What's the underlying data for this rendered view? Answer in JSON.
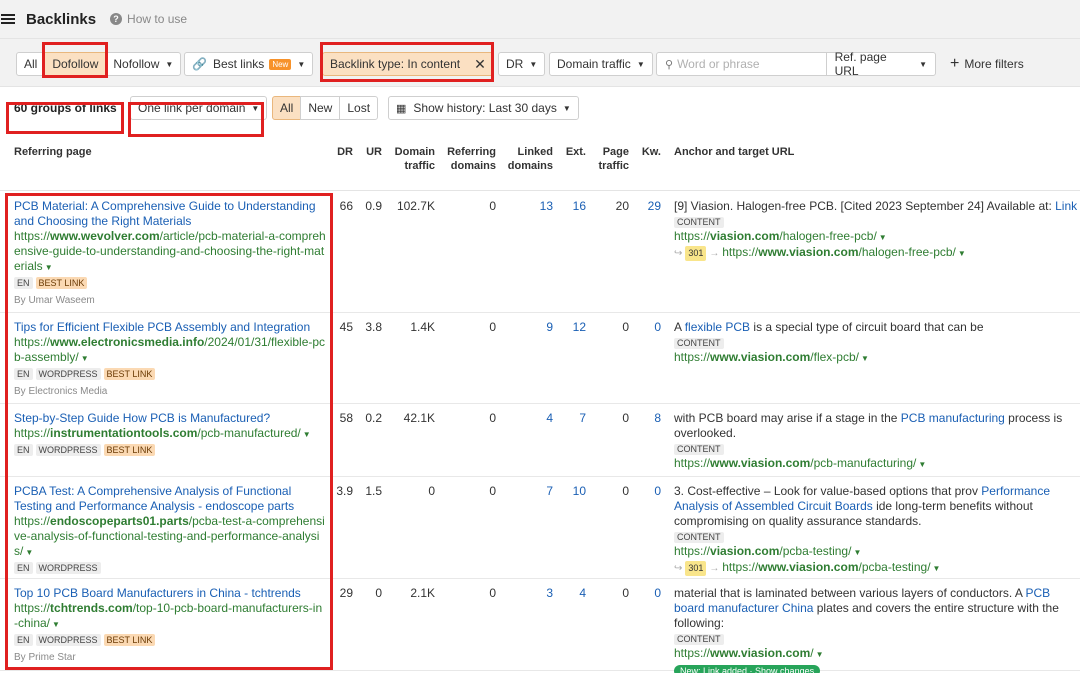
{
  "header": {
    "title": "Backlinks",
    "help": "How to use"
  },
  "filters": {
    "all": "All",
    "dofollow": "Dofollow",
    "nofollow": "Nofollow",
    "best_links": "Best links",
    "best_links_badge": "New",
    "backlink_type": "Backlink type: In content",
    "dr": "DR",
    "domain_traffic": "Domain traffic",
    "search_placeholder": "Word or phrase",
    "search_scope": "Ref. page URL",
    "more_filters": "More filters"
  },
  "subbar": {
    "groups": "60 groups of links",
    "grouping": "One link per domain",
    "tabs": [
      "All",
      "New",
      "Lost"
    ],
    "history": "Show history: Last 30 days"
  },
  "columns": {
    "referring_page": "Referring page",
    "dr": "DR",
    "ur": "UR",
    "domain_traffic": [
      "Domain",
      "traffic"
    ],
    "referring_domains": [
      "Referring",
      "domains"
    ],
    "linked_domains": [
      "Linked",
      "domains"
    ],
    "ext": "Ext.",
    "page_traffic": [
      "Page",
      "traffic"
    ],
    "kw": "Kw.",
    "anchor": "Anchor and target URL"
  },
  "rows": [
    {
      "title": "PCB Material: A Comprehensive Guide to Understanding and Choosing the Right Materials",
      "url_prefix": "https://",
      "url_domain": "www.wevolver.com",
      "url_path": "/article/pcb-material-a-comprehensive-guide-to-understanding-and-choosing-the-right-materials",
      "tags": [
        "EN",
        "BEST LINK"
      ],
      "author": "By Umar Waseem",
      "dr": "66",
      "ur": "0.9",
      "domain_traffic": "102.7K",
      "referring_domains": "0",
      "linked_domains": "13",
      "ext": "16",
      "page_traffic": "20",
      "kw": "29",
      "anchor_text": "[9] Viasion. Halogen-free PCB. [Cited 2023 September 24] Available at: ",
      "anchor_link": "Link",
      "anchor_after": "",
      "content": "CONTENT",
      "target_prefix": "https://",
      "target_domain": "viasion.com",
      "target_path": "/halogen-free-pcb/",
      "redirect": "301",
      "redirect_prefix": "https://",
      "redirect_domain": "www.viasion.com",
      "redirect_path": "/halogen-free-pcb/"
    },
    {
      "title": "Tips for Efficient Flexible PCB Assembly and Integration",
      "url_prefix": "https://",
      "url_domain": "www.electronicsmedia.info",
      "url_path": "/2024/01/31/flexible-pcb-assembly/",
      "tags": [
        "EN",
        "WORDPRESS",
        "BEST LINK"
      ],
      "author": "By Electronics Media",
      "dr": "45",
      "ur": "3.8",
      "domain_traffic": "1.4K",
      "referring_domains": "0",
      "linked_domains": "9",
      "ext": "12",
      "page_traffic": "0",
      "kw": "0",
      "anchor_text": "A ",
      "anchor_link": "flexible PCB",
      "anchor_after": " is a special type of circuit board that can be",
      "content": "CONTENT",
      "target_prefix": "https://",
      "target_domain": "www.viasion.com",
      "target_path": "/flex-pcb/"
    },
    {
      "title": "Step-by-Step Guide How PCB is Manufactured?",
      "url_prefix": "https://",
      "url_domain": "instrumentationtools.com",
      "url_path": "/pcb-manufactured/",
      "tags": [
        "EN",
        "WORDPRESS",
        "BEST LINK"
      ],
      "author": "",
      "dr": "58",
      "ur": "0.2",
      "domain_traffic": "42.1K",
      "referring_domains": "0",
      "linked_domains": "4",
      "ext": "7",
      "page_traffic": "0",
      "kw": "8",
      "anchor_text": "with PCB board may arise if a stage in the ",
      "anchor_link": "PCB manufacturing",
      "anchor_after": " process is overlooked.",
      "content": "CONTENT",
      "target_prefix": "https://",
      "target_domain": "www.viasion.com",
      "target_path": "/pcb-manufacturing/"
    },
    {
      "title": "PCBA Test: A Comprehensive Analysis of Functional Testing and Performance Analysis - endoscope parts",
      "url_prefix": "https://",
      "url_domain": "endoscopeparts01.parts",
      "url_path": "/pcba-test-a-comprehensive-analysis-of-functional-testing-and-performance-analysis/",
      "tags": [
        "EN",
        "WORDPRESS"
      ],
      "author": "",
      "dr": "3.9",
      "ur": "1.5",
      "domain_traffic": "0",
      "referring_domains": "0",
      "linked_domains": "7",
      "ext": "10",
      "page_traffic": "0",
      "kw": "0",
      "anchor_text": "3. Cost-effective – Look for value-based options that prov ",
      "anchor_link": "Performance Analysis of Assembled Circuit Boards",
      "anchor_after": " ide long-term benefits without compromising on quality assurance standards.",
      "content": "CONTENT",
      "target_prefix": "https://",
      "target_domain": "viasion.com",
      "target_path": "/pcba-testing/",
      "redirect": "301",
      "redirect_prefix": "https://",
      "redirect_domain": "www.viasion.com",
      "redirect_path": "/pcba-testing/"
    },
    {
      "title": "Top 10 PCB Board Manufacturers in China - tchtrends",
      "url_prefix": "https://",
      "url_domain": "tchtrends.com",
      "url_path": "/top-10-pcb-board-manufacturers-in-china/",
      "tags": [
        "EN",
        "WORDPRESS",
        "BEST LINK"
      ],
      "author": "By Prime Star",
      "dr": "29",
      "ur": "0",
      "domain_traffic": "2.1K",
      "referring_domains": "0",
      "linked_domains": "3",
      "ext": "4",
      "page_traffic": "0",
      "kw": "0",
      "anchor_text": "material that is laminated between various layers of conductors. A ",
      "anchor_link": "PCB board manufacturer China",
      "anchor_after": " plates and covers the entire structure with the following:",
      "content": "CONTENT",
      "target_prefix": "https://",
      "target_domain": "www.viasion.com",
      "target_path": "/",
      "new_label": "New: Link added · Show changes"
    }
  ],
  "colors": {
    "accent_link": "#1a5fb4",
    "url_green": "#2f7d32",
    "highlight": "#e02020",
    "active_filter": "#fbe0c2"
  }
}
